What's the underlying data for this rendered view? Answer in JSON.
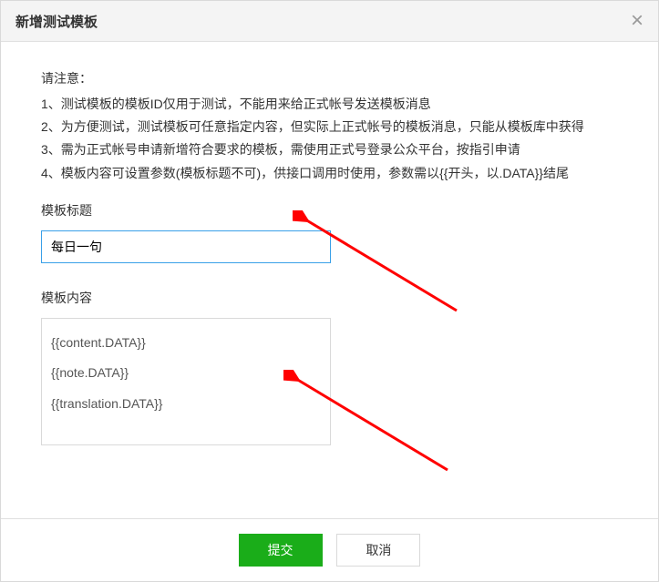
{
  "dialog": {
    "title": "新增测试模板",
    "close_label": "×"
  },
  "notice": {
    "title": "请注意：",
    "items": [
      "1、测试模板的模板ID仅用于测试，不能用来给正式帐号发送模板消息",
      "2、为方便测试，测试模板可任意指定内容，但实际上正式帐号的模板消息，只能从模板库中获得",
      "3、需为正式帐号申请新增符合要求的模板，需使用正式号登录公众平台，按指引申请",
      "4、模板内容可设置参数(模板标题不可)，供接口调用时使用，参数需以{{开头，以.DATA}}结尾"
    ]
  },
  "form": {
    "title_label": "模板标题",
    "title_value": "每日一句",
    "content_label": "模板内容",
    "content_value": "{{content.DATA}}\n{{note.DATA}}\n{{translation.DATA}}"
  },
  "footer": {
    "submit_label": "提交",
    "cancel_label": "取消"
  }
}
